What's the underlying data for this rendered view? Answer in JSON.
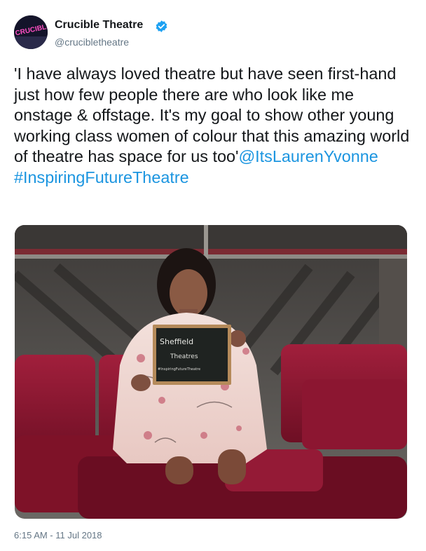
{
  "account": {
    "display_name": "Crucible Theatre",
    "handle": "@crucibletheatre",
    "avatar_text": "CRUCIBLE",
    "verified_icon": "verified-badge-icon",
    "verified_color": "#1da1f2"
  },
  "tweet": {
    "text": "'I have always loved theatre but have seen first-hand just how few people there are who look like me onstage & offstage. It's my goal to show other young working class women of colour that this amazing world of theatre has space for us too'",
    "mention": "@ItsLaurenYvonne",
    "hashtag": "#InspiringFutureTheatre",
    "link_color": "#1b95e0"
  },
  "media": {
    "chalkboard_line1": "Sheffield",
    "chalkboard_line2": "Theatres",
    "chalkboard_line3": "#InspiringFutureTheatre"
  },
  "timestamp": "6:15 AM - 11 Jul 2018"
}
